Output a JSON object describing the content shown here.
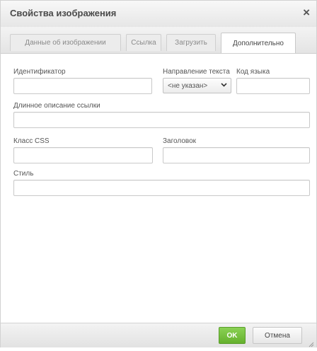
{
  "dialog": {
    "title": "Свойства изображения",
    "close_symbol": "×"
  },
  "tabs": [
    {
      "label": "Данные об изображении",
      "active": false
    },
    {
      "label": "Ссылка",
      "active": false
    },
    {
      "label": "Загрузить",
      "active": false
    },
    {
      "label": "Дополнительно",
      "active": true
    }
  ],
  "form": {
    "id_label": "Идентификатор",
    "id_value": "",
    "text_direction_label": "Направление текста",
    "text_direction_value": "<не указан>",
    "lang_code_label": "Код языка",
    "lang_code_value": "",
    "long_desc_label": "Длинное описание ссылки",
    "long_desc_value": "",
    "css_class_label": "Класс CSS",
    "css_class_value": "",
    "title_label": "Заголовок",
    "title_value": "",
    "style_label": "Стиль",
    "style_value": ""
  },
  "footer": {
    "ok_label": "OK",
    "cancel_label": "Отмена"
  },
  "icons": {
    "close": "close-icon",
    "chevron": "chevron-down-icon",
    "resize": "resize-grip-icon"
  },
  "colors": {
    "ok_button": "#6bb634",
    "border": "#c9c9c9"
  }
}
